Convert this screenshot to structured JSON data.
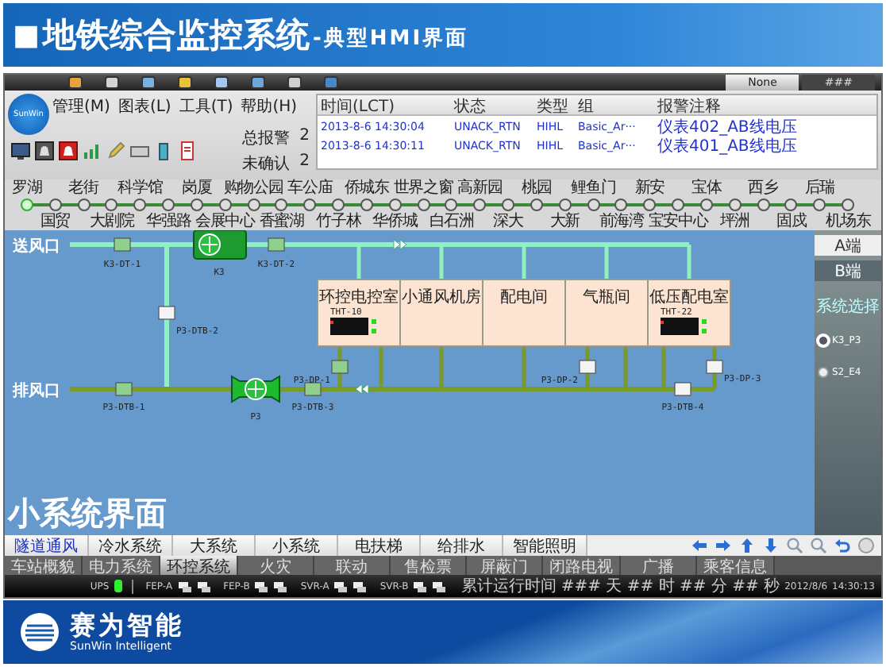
{
  "slide": {
    "bullet": "■",
    "title": "地铁综合监控系统",
    "subtitle": "-典型HMI界面",
    "caption": "小系统界面",
    "brand": "赛为智能",
    "brand_en": "SunWin Intelligent"
  },
  "hmi": {
    "logo": "SunWin",
    "window_tabs": [
      {
        "label": "None",
        "selected": true
      },
      {
        "label": "###",
        "selected": false
      }
    ],
    "menu": [
      "管理(M)",
      "图表(L)",
      "工具(T)",
      "帮助(H)"
    ],
    "alarm_counts": [
      {
        "label": "总报警",
        "value": "2"
      },
      {
        "label": "未确认",
        "value": "2"
      }
    ],
    "alarm_table": {
      "columns": [
        "时间(LCT)",
        "状态",
        "类型",
        "组",
        "报警注释"
      ],
      "rows": [
        [
          "2013-8-6 14:30:04",
          "UNACK_RTN",
          "HIHL",
          "Basic_Ar···",
          "仪表402_AB线电压"
        ],
        [
          "2013-8-6 14:30:11",
          "UNACK_RTN",
          "HIHL",
          "Basic_Ar···",
          "仪表401_AB线电压"
        ]
      ]
    },
    "stations": [
      {
        "name": "罗湖",
        "selected": true
      },
      {
        "name": "老街",
        "selected": false
      },
      {
        "name": "科学馆",
        "selected": false
      },
      {
        "name": "岗厦",
        "selected": false
      },
      {
        "name": "购物公园",
        "selected": false
      },
      {
        "name": "车公庙",
        "selected": false
      },
      {
        "name": "侨城东",
        "selected": false
      },
      {
        "name": "世界之窗",
        "selected": false
      },
      {
        "name": "高新园",
        "selected": false
      },
      {
        "name": "桃园",
        "selected": false
      },
      {
        "name": "鲤鱼门",
        "selected": false
      },
      {
        "name": "新安",
        "selected": false
      },
      {
        "name": "宝体",
        "selected": false
      },
      {
        "name": "西乡",
        "selected": false
      },
      {
        "name": "后瑞",
        "selected": false
      },
      {
        "name": "国贸",
        "selected": false
      },
      {
        "name": "大剧院",
        "selected": false
      },
      {
        "name": "华强路",
        "selected": false
      },
      {
        "name": "会展中心",
        "selected": false
      },
      {
        "name": "香蜜湖",
        "selected": false
      },
      {
        "name": "竹子林",
        "selected": false
      },
      {
        "name": "华侨城",
        "selected": false
      },
      {
        "name": "白石洲",
        "selected": false
      },
      {
        "name": "深大",
        "selected": false
      },
      {
        "name": "大新",
        "selected": false
      },
      {
        "name": "前海湾",
        "selected": false
      },
      {
        "name": "宝安中心",
        "selected": false
      },
      {
        "name": "坪洲",
        "selected": false
      },
      {
        "name": "固戍",
        "selected": false
      },
      {
        "name": "机场东",
        "selected": false
      }
    ],
    "diagram": {
      "supply_label": "送风口",
      "exhaust_label": "排风口",
      "fans": [
        {
          "label": "K3"
        },
        {
          "label": "P3"
        }
      ],
      "dampers": [
        {
          "label": "K3-DT-1",
          "open": true
        },
        {
          "label": "K3-DT-2",
          "open": true
        },
        {
          "label": "P3-DTB-2",
          "open": false
        },
        {
          "label": "P3-DTB-1",
          "open": true
        },
        {
          "label": "P3-DTB-3",
          "open": true
        },
        {
          "label": "P3-DP-1",
          "open": true
        },
        {
          "label": "P3-DP-2",
          "open": false
        },
        {
          "label": "P3-DP-3",
          "open": false
        },
        {
          "label": "P3-DTB-4",
          "open": false
        }
      ],
      "rooms": [
        {
          "name": "环控电控室",
          "sensor": "THT-10"
        },
        {
          "name": "小通风机房"
        },
        {
          "name": "配电间"
        },
        {
          "name": "气瓶间"
        },
        {
          "name": "低压配电室",
          "sensor": "THT-22"
        }
      ]
    },
    "side_panel": {
      "ends": [
        {
          "label": "A端",
          "selected": true
        },
        {
          "label": "B端",
          "selected": false
        }
      ],
      "heading": "系统选择",
      "options": [
        {
          "label": "K3_P3",
          "selected": true
        },
        {
          "label": "S2_E4",
          "selected": false
        }
      ]
    },
    "system_tabs": [
      {
        "label": "隧道通风",
        "selected": true
      },
      {
        "label": "冷水系统",
        "selected": false
      },
      {
        "label": "大系统",
        "selected": false
      },
      {
        "label": "小系统",
        "selected": false
      },
      {
        "label": "电扶梯",
        "selected": false
      },
      {
        "label": "给排水",
        "selected": false
      },
      {
        "label": "智能照明",
        "selected": false
      }
    ],
    "nav_tabs": [
      {
        "label": "车站概貌",
        "selected": false
      },
      {
        "label": "电力系统",
        "selected": false
      },
      {
        "label": "环控系统",
        "selected": true
      },
      {
        "label": "火灾",
        "selected": false
      },
      {
        "label": "联动",
        "selected": false
      },
      {
        "label": "售检票",
        "selected": false
      },
      {
        "label": "屏蔽门",
        "selected": false
      },
      {
        "label": "闭路电视",
        "selected": false
      },
      {
        "label": "广播",
        "selected": false
      },
      {
        "label": "乘客信息",
        "selected": false
      }
    ],
    "status_bar": {
      "items": [
        {
          "kind": "indicator",
          "label": "UPS",
          "on": true
        },
        {
          "kind": "servers",
          "label": "FEP-A"
        },
        {
          "kind": "servers",
          "label": "FEP-B"
        },
        {
          "kind": "servers",
          "label": "SVR-A"
        },
        {
          "kind": "servers",
          "label": "SVR-B"
        }
      ],
      "runtime": "累计运行时间 ### 天 ## 时 ## 分 ## 秒",
      "date": "2012/8/6",
      "time": "14:30:13"
    }
  }
}
